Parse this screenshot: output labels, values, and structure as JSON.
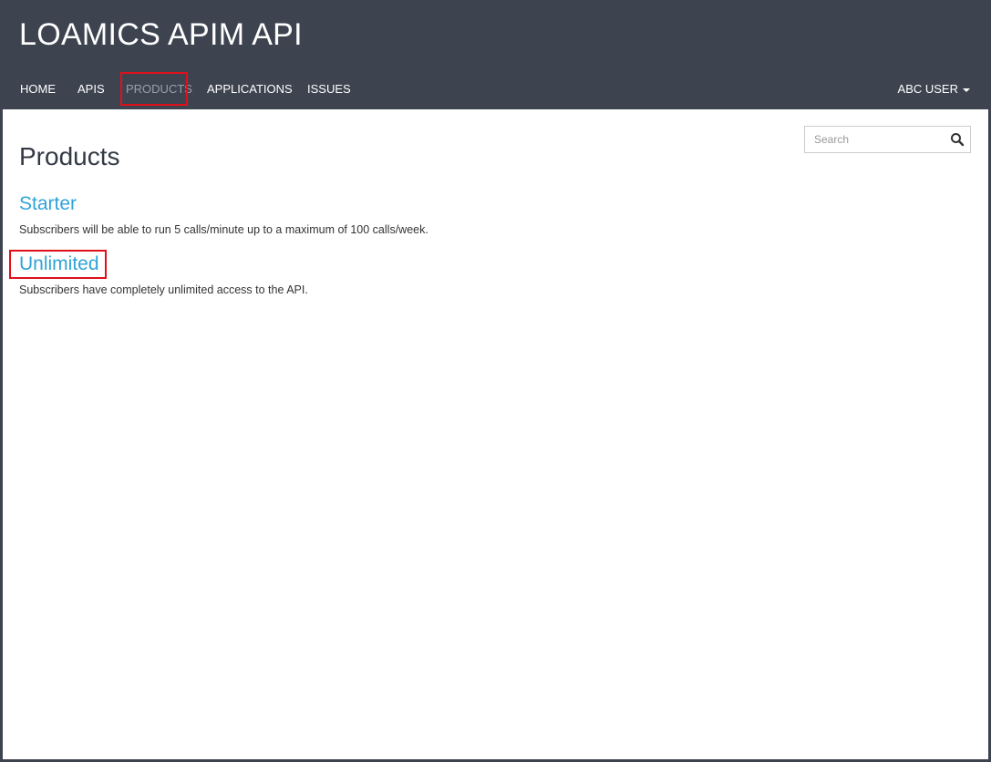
{
  "site": {
    "title": "LOAMICS APIM API"
  },
  "nav": {
    "items": [
      {
        "label": "HOME"
      },
      {
        "label": "APIS"
      },
      {
        "label": "PRODUCTS"
      },
      {
        "label": "APPLICATIONS"
      },
      {
        "label": "ISSUES"
      }
    ],
    "user_label": "ABC USER"
  },
  "search": {
    "placeholder": "Search",
    "value": ""
  },
  "main": {
    "page_title": "Products",
    "products": [
      {
        "name": "Starter",
        "description": "Subscribers will be able to run 5 calls/minute up to a maximum of 100 calls/week."
      },
      {
        "name": "Unlimited",
        "description": "Subscribers have completely unlimited access to the API."
      }
    ]
  },
  "colors": {
    "header_bg": "#3d4450",
    "link": "#2fa4d8",
    "highlight": "#e0101a"
  }
}
